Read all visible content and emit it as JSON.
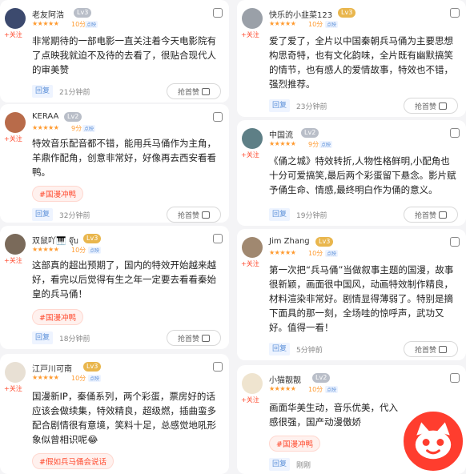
{
  "cards": [
    {
      "name": "老友阿浩",
      "level": "Lv3",
      "stars": "★★★★★",
      "score": "10分",
      "mark": "点映",
      "follow": "+关注",
      "text": "非常期待的一部电影一直关注着今天电影院有了点映我就迫不及待的去看了，很贴合现代人的审美赞",
      "tag": "",
      "reply": "回复",
      "time": "21分钟前",
      "grab": "抢首赞"
    },
    {
      "name": "快乐的小韭菜123",
      "level": "Lv3",
      "stars": "★★★★★",
      "score": "10分",
      "mark": "点映",
      "follow": "+关注",
      "text": "爱了爱了，全片以中国秦朝兵马俑为主要思想构思奇特，也有文化韵味，全片既有幽默搞笑的情节，也有感人的爱情故事，特效也不错，强烈推荐。",
      "tag": "",
      "reply": "回复",
      "time": "23分钟前",
      "grab": "抢首赞"
    },
    {
      "name": "KERAA",
      "level": "Lv2",
      "stars": "★★★★★",
      "score": "9分",
      "mark": "点映",
      "follow": "+关注",
      "text": "特效音乐配音都不错，能用兵马俑作为主角，羊鼎作配角，创意非常好，好像再去西安看看鸭。",
      "tag": "#国漫冲鸭",
      "reply": "回复",
      "time": "32分钟前",
      "grab": "抢首赞"
    },
    {
      "name": "中国流",
      "level": "Lv2",
      "stars": "★★★★★",
      "score": "9分",
      "mark": "点映",
      "follow": "+关注",
      "text": "《俑之城》特效转折,人物性格鲜明,小配角也十分可爱搞笑,最后两个彩蛋留下悬念。影片赋予俑生命、情感,最终明白作为俑的意义。",
      "tag": "",
      "reply": "回复",
      "time": "19分钟前",
      "grab": "抢首赞"
    },
    {
      "name": "双鼠吖🎹 จุ๊บ",
      "level": "Lv3",
      "stars": "★★★★★",
      "score": "10分",
      "mark": "点映",
      "follow": "+关注",
      "text": "这部真的超出预期了，国内的特效开始越来越好，看完以后觉得有生之年一定要去看看秦始皇的兵马俑！",
      "tag": "#国漫冲鸭",
      "reply": "回复",
      "time": "18分钟前",
      "grab": "抢首赞"
    },
    {
      "name": "Jim Zhang",
      "level": "Lv3",
      "stars": "★★★★★",
      "score": "10分",
      "mark": "点映",
      "follow": "+关注",
      "text": "第一次把“兵马俑”当做叙事主题的国漫，故事很新颖，画面很中国风，动画特效制作精良，材料渲染非常好。剧情显得薄弱了。特别是摘下面具的那一刻，全场哇的惊呼声，武功又好。值得一看！",
      "tag": "",
      "reply": "回复",
      "time": "5分钟前",
      "grab": "抢首赞"
    },
    {
      "name": "江戸川可南",
      "level": "Lv3",
      "stars": "★★★★★",
      "score": "10分",
      "mark": "点映",
      "follow": "+关注",
      "text": "国漫新IP，秦俑系列，两个彩蛋，票房好的话应该会做续集，特效精良，超级燃，插曲蛮多配合剧情很有意境，笑料十足，总感觉地吼形象似曾相识呢😂",
      "tag": "#假如兵马俑会说话",
      "reply": "回复",
      "time": "",
      "grab": ""
    },
    {
      "name": "小猫靓靓",
      "level": "Lv2",
      "stars": "★★★★★",
      "score": "10分",
      "mark": "点映",
      "follow": "+关注",
      "text": "画面华美生动，音乐优美，代入感很强，国产动漫傲娇",
      "tag": "#国漫冲鸭",
      "reply": "回复",
      "time": "刚刚",
      "grab": ""
    }
  ],
  "brand_color": "#ff3d2e"
}
